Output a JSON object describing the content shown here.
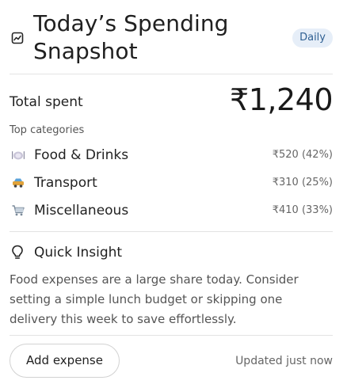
{
  "header": {
    "icon": "chart-line-icon",
    "title": "Today’s Spending Snapshot",
    "badge": "Daily"
  },
  "summary": {
    "total_label": "Total spent",
    "total_value": "₹1,240"
  },
  "categories": {
    "label": "Top categories",
    "items": [
      {
        "icon": "plate-icon",
        "name": "Food & Drinks",
        "amount": "₹520 (42%)"
      },
      {
        "icon": "car-icon",
        "name": "Transport",
        "amount": "₹310 (25%)"
      },
      {
        "icon": "shopping-cart-icon",
        "name": "Miscellaneous",
        "amount": "₹410 (33%)"
      }
    ]
  },
  "insight": {
    "icon": "lightbulb-icon",
    "title": "Quick Insight",
    "text": "Food expenses are a large share today. Consider setting a simple lunch budget or skipping one delivery this week to save effortlessly."
  },
  "footer": {
    "add_label": "Add expense",
    "updated": "Updated just now"
  },
  "colors": {
    "badge_bg": "#e6eef8",
    "badge_text": "#2e5f92",
    "text_primary": "#1f1f1f",
    "text_muted": "#666666"
  }
}
